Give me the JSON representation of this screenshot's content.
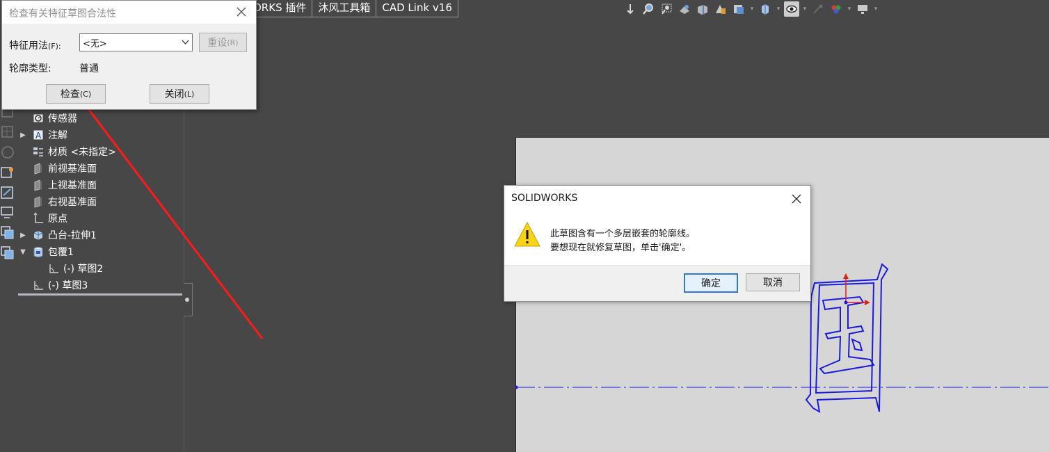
{
  "tabs": [
    "ORKS 插件",
    "沐风工具箱",
    "CAD Link v16"
  ],
  "toolbar_icons": [
    "view-orientation-icon",
    "zoom-to-fit-icon",
    "zoom-area-icon",
    "previous-view-icon",
    "section-view-icon",
    "dynamic-annotation-icon",
    "view-settings-icon",
    "display-style-icon",
    "hide-show-icon",
    "edit-appearance-icon",
    "apply-scene-icon",
    "view-setting-monitor-icon"
  ],
  "feature_tree": [
    {
      "label": "传感器",
      "icon": "sensor-icon",
      "expandable": false
    },
    {
      "label": "注解",
      "icon": "annotation-icon",
      "expandable": true
    },
    {
      "label": "材质 <未指定>",
      "icon": "material-icon",
      "expandable": false
    },
    {
      "label": "前视基准面",
      "icon": "plane-icon",
      "expandable": false
    },
    {
      "label": "上视基准面",
      "icon": "plane-icon",
      "expandable": false
    },
    {
      "label": "右视基准面",
      "icon": "plane-icon",
      "expandable": false
    },
    {
      "label": "原点",
      "icon": "origin-icon",
      "expandable": false
    },
    {
      "label": "凸台-拉伸1",
      "icon": "extrude-icon",
      "expandable": true
    },
    {
      "label": "包覆1",
      "icon": "wrap-icon",
      "expanded": true
    },
    {
      "label": "(-) 草图2",
      "icon": "sketch-icon",
      "expandable": false
    },
    {
      "label": "(-) 草图3",
      "icon": "sketch-icon",
      "expandable": false
    }
  ],
  "check_dialog": {
    "title": "检查有关特征草图合法性",
    "usage_label": "特征用法",
    "usage_hotkey": "(F):",
    "usage_value": "<无>",
    "reset_label": "重设",
    "reset_hotkey": "(R)",
    "contour_label": "轮廓类型:",
    "contour_value": "普通",
    "check_label": "检查",
    "check_hotkey": "(C)",
    "close_label": "关闭",
    "close_hotkey": "(L)"
  },
  "message_dialog": {
    "title": "SOLIDWORKS",
    "line1": "此草图含有一个多层嵌套的轮廓线。",
    "line2": "要想现在就修复草图，单击'确定'。",
    "ok_label": "确定",
    "cancel_label": "取消"
  },
  "colors": {
    "background": "#474747",
    "viewport": "#d6d6d6",
    "sketch_blue": "#1a1adf",
    "arrow_red": "#ff1a1a",
    "focus_blue": "#3277d0",
    "warning_yellow": "#f7d417"
  }
}
